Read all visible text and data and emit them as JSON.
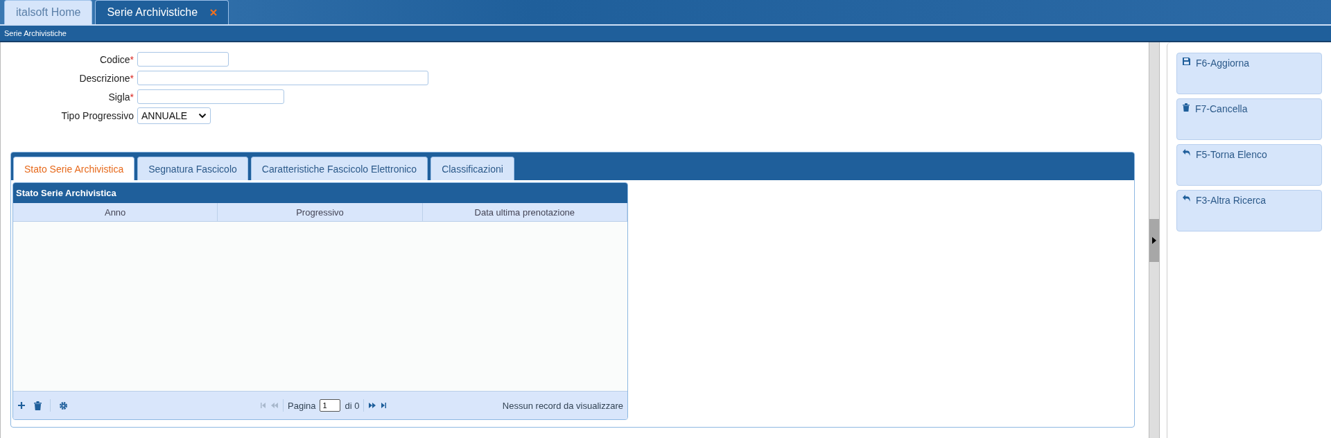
{
  "app_tabs": [
    {
      "label": "italsoft Home",
      "selected": false,
      "closable": false
    },
    {
      "label": "Serie Archivistiche",
      "selected": true,
      "closable": true
    }
  ],
  "page_title": "Serie Archivistiche",
  "form": {
    "required_mark": "*",
    "fields": [
      {
        "label": "Codice",
        "required": true,
        "kind": "text"
      },
      {
        "label": "Descrizione",
        "required": true,
        "kind": "text"
      },
      {
        "label": "Sigla",
        "required": true,
        "kind": "text"
      },
      {
        "label": "Tipo Progressivo",
        "required": false,
        "kind": "select",
        "value": "ANNUALE"
      }
    ]
  },
  "tabs": [
    {
      "label": "Stato Serie Archivistica",
      "selected": true
    },
    {
      "label": "Segnatura Fascicolo",
      "selected": false
    },
    {
      "label": "Caratteristiche Fascicolo Elettronico",
      "selected": false
    },
    {
      "label": "Classificazioni",
      "selected": false
    }
  ],
  "grid": {
    "title": "Stato Serie Archivistica",
    "columns": [
      "Anno",
      "Progressivo",
      "Data ultima prenotazione"
    ],
    "pager": {
      "page_label": "Pagina",
      "page": "1",
      "of_label": "di 0"
    },
    "status": "Nessun record da visualizzare"
  },
  "actions": [
    {
      "label": "F6-Aggiorna",
      "kind": "save"
    },
    {
      "label": "F7-Cancella",
      "kind": "delete"
    },
    {
      "label": "F5-Torna Elenco",
      "kind": "back"
    },
    {
      "label": "F3-Altra Ricerca",
      "kind": "back"
    }
  ]
}
